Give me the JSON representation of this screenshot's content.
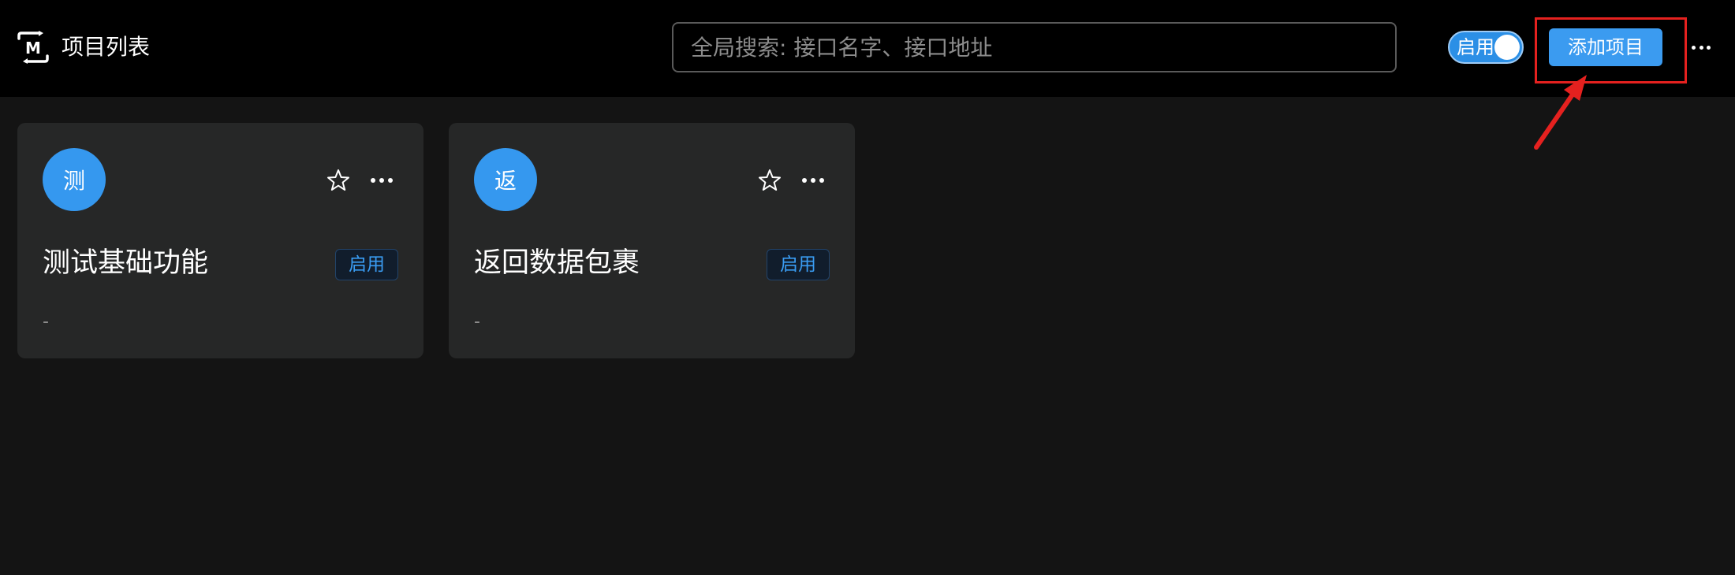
{
  "header": {
    "title": "项目列表",
    "logo_icon": "project-logo-icon",
    "search": {
      "placeholder": "全局搜索: 接口名字、接口地址",
      "value": ""
    },
    "toggle": {
      "label": "启用",
      "on": true
    },
    "add_button_label": "添加项目",
    "more_icon": "more-horizontal-icon"
  },
  "projects": [
    {
      "avatar": "测",
      "name": "测试基础功能",
      "status": "启用",
      "description": "-"
    },
    {
      "avatar": "返",
      "name": "返回数据包裹",
      "status": "启用",
      "description": "-"
    }
  ],
  "colors": {
    "accent": "#3b9bf0",
    "highlight": "#e5211f",
    "background": "#141414",
    "card": "#262727",
    "topbar": "#000000"
  }
}
